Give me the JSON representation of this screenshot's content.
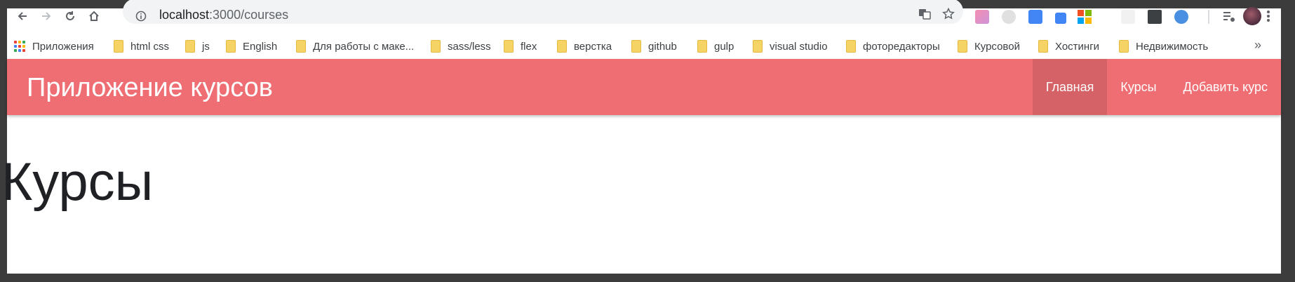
{
  "browser": {
    "url_host": "localhost",
    "url_path": ":3000/courses"
  },
  "bookmarks": {
    "apps_label": "Приложения",
    "items": [
      "html css",
      "js",
      "English",
      "Для работы с маке...",
      "sass/less",
      "flex",
      "верстка",
      "github",
      "gulp",
      "visual studio",
      "фоторедакторы",
      "Курсовой",
      "Хостинги",
      "Недвижимость"
    ],
    "more_label": "»"
  },
  "navbar": {
    "brand": "Приложение курсов",
    "links": [
      "Главная",
      "Курсы",
      "Добавить курс"
    ],
    "active_index": 0
  },
  "page": {
    "heading": "Курсы"
  },
  "colors": {
    "navbar_bg": "#ee6e73",
    "frame": "#3c3c3c"
  }
}
